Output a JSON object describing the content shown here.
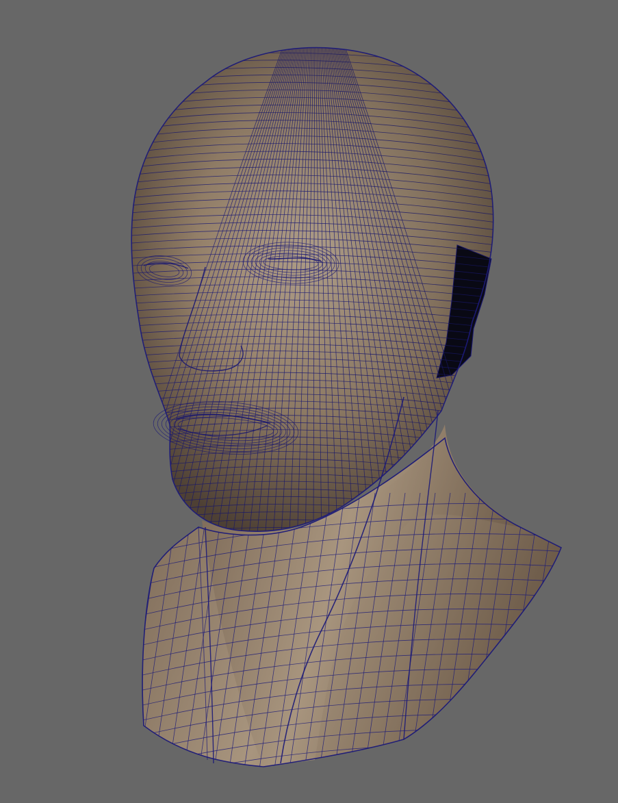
{
  "viewport": {
    "background_color": "#676767",
    "subject": "wireframe-head-bust"
  },
  "model": {
    "skin_light": "#b4a28c",
    "skin_mid": "#97826a",
    "skin_dark": "#5f4e3f",
    "wire_color": "#1c1a78",
    "interior_color": "#0b0b18"
  }
}
